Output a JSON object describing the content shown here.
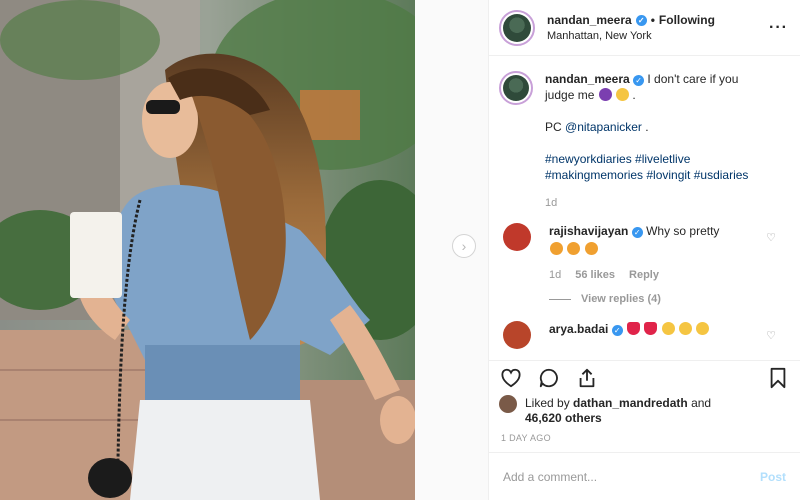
{
  "header": {
    "username": "nandan_meera",
    "separator": "•",
    "follow_status": "Following",
    "location": "Manhattan, New York",
    "more_icon": "more-horizontal-icon"
  },
  "caption": {
    "username": "nandan_meera",
    "text": "I don't care if you judge me",
    "credit": "PC",
    "credit_handle": "@nitapanicker",
    "credit_tail": ".",
    "hashtags": "#newyorkdiaries #liveletlive #makingmemories #lovingit #usdiaries",
    "time": "1d"
  },
  "comments": [
    {
      "username": "rajishavijayan",
      "text": "Why so pretty",
      "time": "1d",
      "likes": "56 likes",
      "reply": "Reply",
      "view_replies": "View replies (4)"
    },
    {
      "username": "arya.badai",
      "text": ""
    }
  ],
  "actions": {
    "like_icon": "heart-icon",
    "comment_icon": "comment-icon",
    "share_icon": "share-icon",
    "save_icon": "bookmark-icon"
  },
  "likes": {
    "prefix": "Liked by",
    "user": "dathan_mandredath",
    "middle": "and",
    "count": "46,620 others"
  },
  "post_time": "1 DAY AGO",
  "add_comment": {
    "placeholder": "Add a comment...",
    "post_label": "Post"
  },
  "colors": {
    "link": "#003569",
    "verified": "#3897f0",
    "post_disabled": "#b2dffc",
    "muted": "#999999"
  }
}
